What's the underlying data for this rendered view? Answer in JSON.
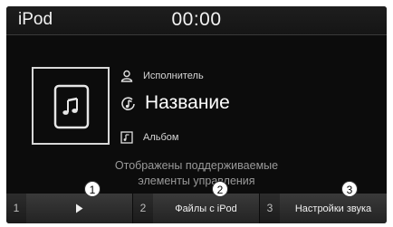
{
  "header": {
    "app_title": "iPod",
    "clock": "00:00"
  },
  "now_playing": {
    "artist": "Исполнитель",
    "title": "Название",
    "album": "Альбом",
    "artwork_icon": "music-file-icon",
    "artist_icon": "person-icon",
    "title_icon": "music-note-icon",
    "album_icon": "album-icon"
  },
  "notice": {
    "line1": "Отображены поддерживаемые",
    "line2": "элементы управления"
  },
  "softkeys": [
    {
      "number": "1",
      "label": "",
      "icon": "play-icon"
    },
    {
      "number": "2",
      "label": "Файлы с iPod"
    },
    {
      "number": "3",
      "label": "Настройки звука"
    }
  ],
  "callouts": [
    "1",
    "2",
    "3"
  ]
}
